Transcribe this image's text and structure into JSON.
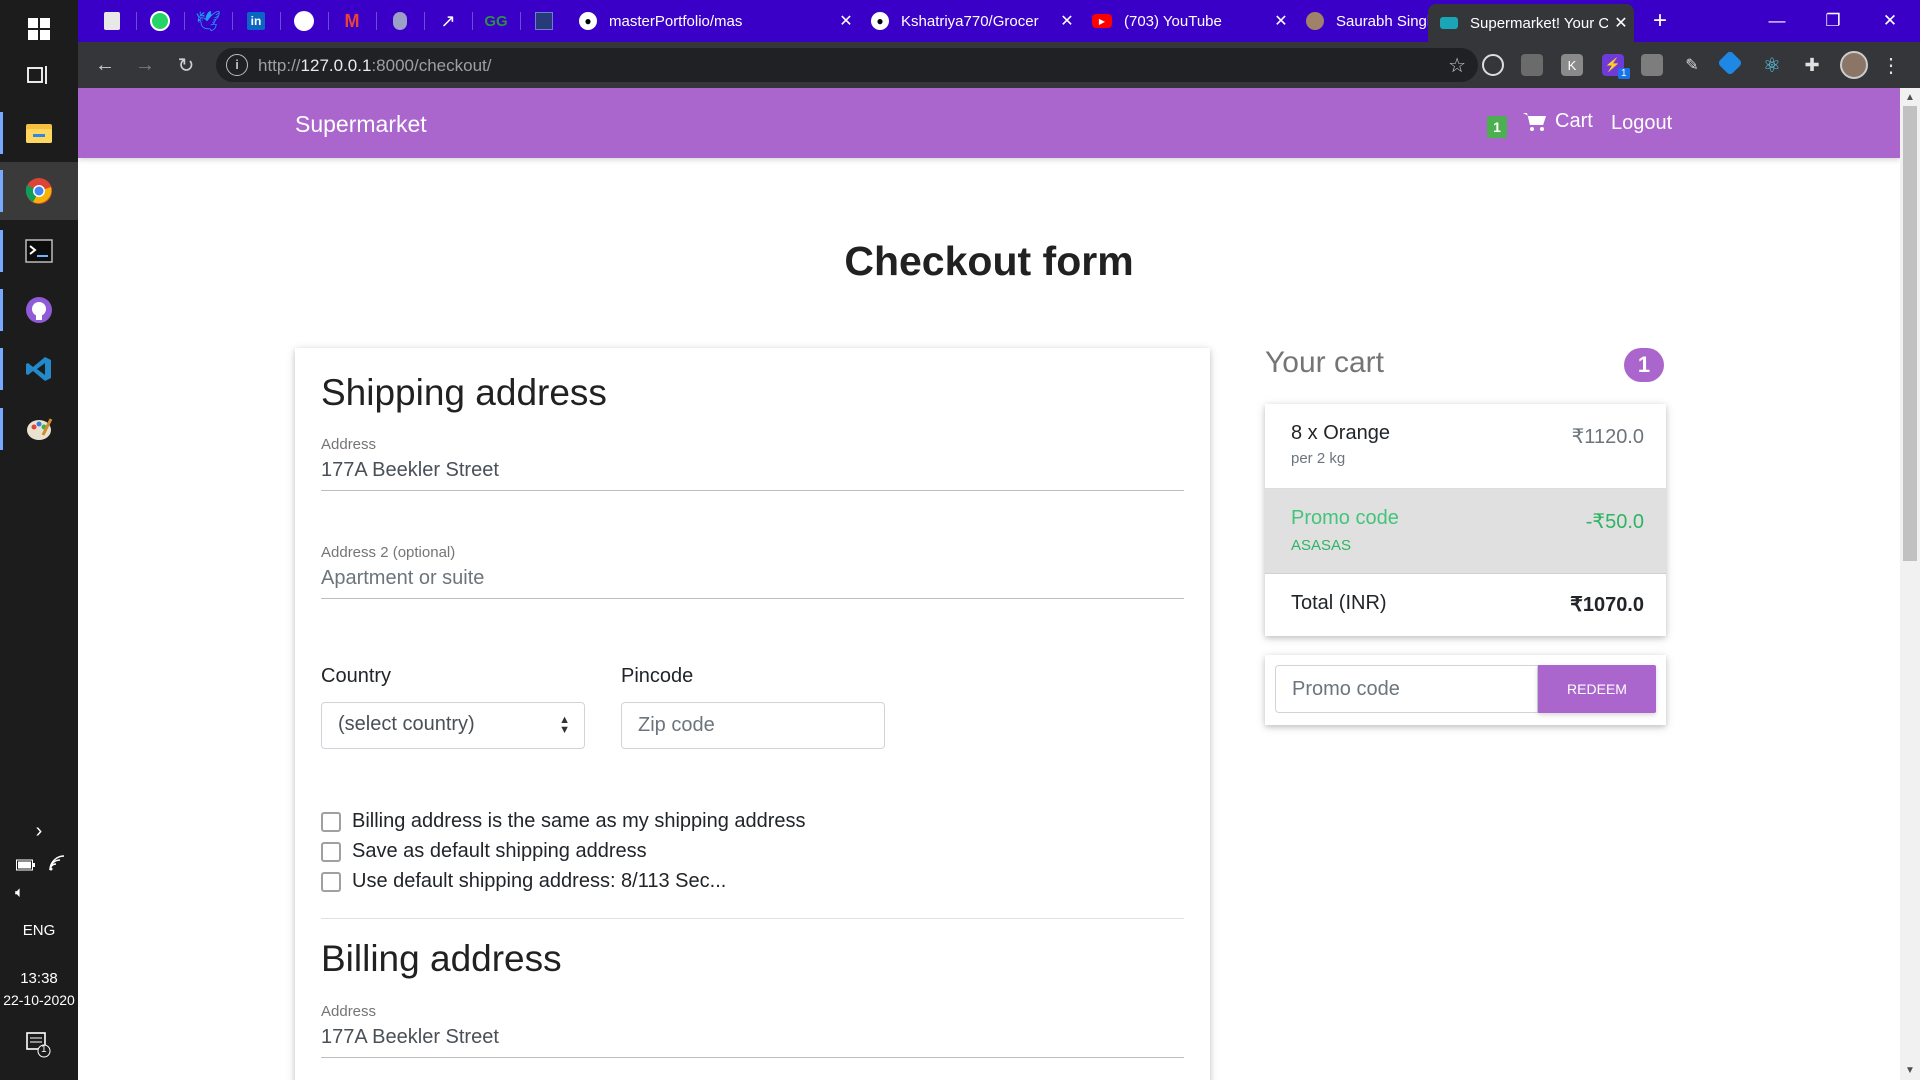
{
  "taskbar": {
    "apps": [
      {
        "name": "file-explorer"
      },
      {
        "name": "chrome",
        "active": true
      },
      {
        "name": "terminal"
      },
      {
        "name": "github-desktop"
      },
      {
        "name": "vscode"
      },
      {
        "name": "paint"
      }
    ],
    "language": "ENG",
    "time": "13:38",
    "date": "22-10-2020",
    "notification_count": "1"
  },
  "browser": {
    "tabs": [
      {
        "title": "masterPortfolio/mas",
        "icon": "github-icon"
      },
      {
        "title": "Kshatriya770/Grocer",
        "icon": "github-icon"
      },
      {
        "title": "(703) YouTube",
        "icon": "youtube-icon"
      },
      {
        "title": "Saurabh Singh | Port",
        "icon": "avatar-icon"
      },
      {
        "title": "Supermarket! Your C",
        "icon": "site-icon",
        "active": true
      }
    ],
    "url_prefix": "http://",
    "url_host": "127.0.0.1",
    "url_rest": ":8000/checkout/",
    "extension_badge": "1"
  },
  "site": {
    "brand": "Supermarket",
    "cart_count": "1",
    "cart_label": "Cart",
    "logout_label": "Logout",
    "accent_color": "#aa66cc"
  },
  "checkout": {
    "heading": "Checkout form",
    "shipping": {
      "title": "Shipping address",
      "address_label": "Address",
      "address_value": "177A Beekler Street",
      "address2_label": "Address 2 (optional)",
      "address2_placeholder": "Apartment or suite",
      "country_label": "Country",
      "country_selected": "(select country)",
      "pincode_label": "Pincode",
      "pincode_placeholder": "Zip code",
      "options": [
        "Billing address is the same as my shipping address",
        "Save as default shipping address",
        "Use default shipping address: 8/113 Sec..."
      ]
    },
    "billing": {
      "title": "Billing address",
      "address_label": "Address",
      "address_value": "177A Beekler Street"
    }
  },
  "cart": {
    "heading": "Your cart",
    "badge": "1",
    "item": {
      "name": "8 x Orange",
      "sub": "per 2 kg",
      "price": "₹1120.0"
    },
    "promo": {
      "name": "Promo code",
      "code": "ASASAS",
      "price": "-₹50.0",
      "color": "#2eb463"
    },
    "total": {
      "label": "Total (INR)",
      "value": "₹1070.0"
    },
    "promo_placeholder": "Promo code",
    "redeem_label": "REDEEM"
  }
}
